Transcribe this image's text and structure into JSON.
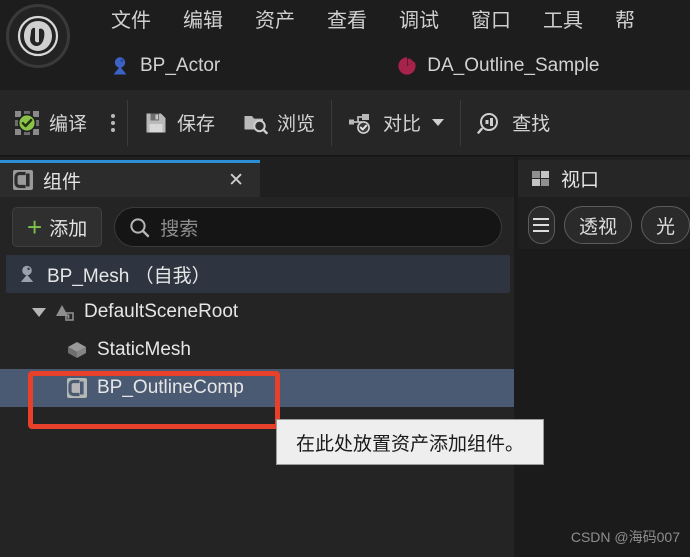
{
  "app": {
    "logo_icon": "unreal-engine-logo",
    "watermark": "CSDN @海码007"
  },
  "menubar": {
    "items": [
      {
        "label": "文件"
      },
      {
        "label": "编辑"
      },
      {
        "label": "资产"
      },
      {
        "label": "查看"
      },
      {
        "label": "调试"
      },
      {
        "label": "窗口"
      },
      {
        "label": "工具"
      },
      {
        "label": "帮"
      }
    ]
  },
  "document_tabs": [
    {
      "label": "BP_Actor",
      "icon": "blueprint-actor-icon",
      "icon_color": "#3b62c4"
    },
    {
      "label": "DA_Outline_Sample",
      "icon": "data-asset-icon",
      "icon_color": "#a8234b"
    }
  ],
  "toolbar": {
    "compile": {
      "label": "编译",
      "icon": "compile-check-icon",
      "status_color": "#8bc34a"
    },
    "compile_options_icon": "kebab-menu-icon",
    "save": {
      "label": "保存",
      "icon": "save-floppy-icon"
    },
    "browse": {
      "label": "浏览",
      "icon": "browse-folder-icon"
    },
    "diff": {
      "label": "对比",
      "icon": "diff-icon",
      "has_dropdown": true
    },
    "find": {
      "label": "查找",
      "icon": "find-magnifier-icon"
    }
  },
  "components_panel": {
    "tab": {
      "label": "组件",
      "icon": "component-icon",
      "close_icon": "close-icon",
      "accent_color": "#2b8fd6"
    },
    "add_button": {
      "label": "添加",
      "icon": "plus-icon",
      "icon_color": "#7ec24a"
    },
    "search": {
      "placeholder": "搜索",
      "value": "",
      "icon": "search-icon"
    },
    "tree": [
      {
        "label": "BP_Mesh （自我）",
        "icon": "actor-root-icon",
        "indent": 0,
        "state": "self",
        "expander": "none"
      },
      {
        "label": "DefaultSceneRoot",
        "icon": "scene-root-icon",
        "indent": 1,
        "state": "normal",
        "expander": "expanded"
      },
      {
        "label": "StaticMesh",
        "icon": "static-mesh-icon",
        "indent": 2,
        "state": "normal",
        "expander": "none"
      },
      {
        "label": "BP_OutlineComp",
        "icon": "component-icon",
        "indent": 2,
        "state": "selected",
        "expander": "none"
      }
    ]
  },
  "annotation": {
    "shape": "rectangle",
    "color": "#e8402a",
    "target": "BP_OutlineComp"
  },
  "tooltip": {
    "text": "在此处放置资产添加组件。",
    "background": "#eeeeee",
    "text_color": "#1a1a1a"
  },
  "viewport_panel": {
    "tab": {
      "label": "视口",
      "icon": "viewport-grid-icon"
    },
    "toolbar": [
      {
        "label": "",
        "icon": "hamburger-menu-icon",
        "shape": "round"
      },
      {
        "label": "透视",
        "icon": "",
        "shape": "pill"
      },
      {
        "label": "光",
        "icon": "",
        "shape": "pill"
      }
    ]
  }
}
